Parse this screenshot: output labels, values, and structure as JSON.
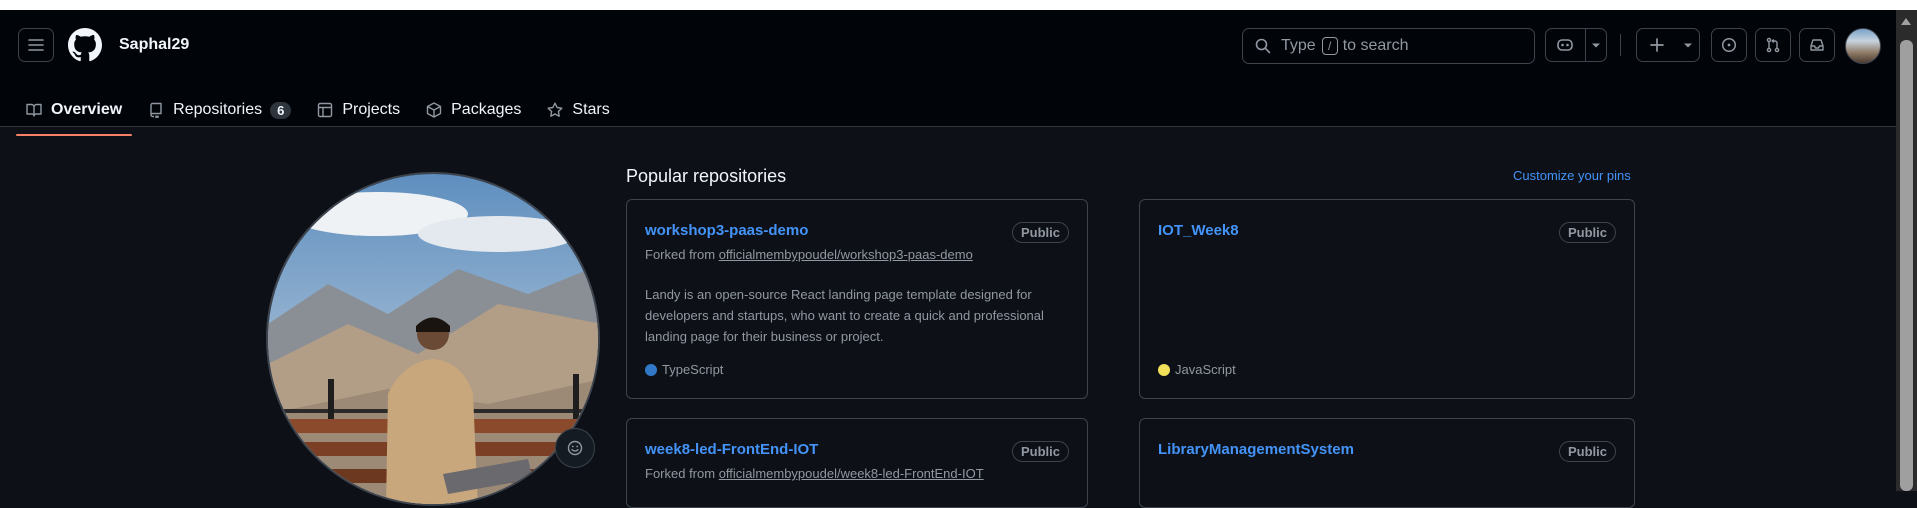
{
  "header": {
    "username": "Saphal29",
    "search_prefix": "Type",
    "search_slash": "/",
    "search_suffix": "to search"
  },
  "nav": {
    "tabs": [
      {
        "label": "Overview",
        "icon": "book-icon",
        "active": true
      },
      {
        "label": "Repositories",
        "icon": "repo-icon",
        "count": "6"
      },
      {
        "label": "Projects",
        "icon": "table-icon"
      },
      {
        "label": "Packages",
        "icon": "package-icon"
      },
      {
        "label": "Stars",
        "icon": "star-icon"
      }
    ]
  },
  "main": {
    "section_title": "Popular repositories",
    "customize_label": "Customize your pins",
    "repos": [
      {
        "name": "workshop3-paas-demo",
        "visibility": "Public",
        "forked_prefix": "Forked from",
        "forked_from": "officialmembypoudel/workshop3-paas-demo",
        "description": "Landy is an open-source React landing page template designed for developers and startups, who want to create a quick and professional landing page for their business or project.",
        "language": "TypeScript",
        "language_color": "#3178c6"
      },
      {
        "name": "IOT_Week8",
        "visibility": "Public",
        "language": "JavaScript",
        "language_color": "#f1e05a"
      },
      {
        "name": "week8-led-FrontEnd-IOT",
        "visibility": "Public",
        "forked_prefix": "Forked from",
        "forked_from": "officialmembypoudel/week8-led-FrontEnd-IOT"
      },
      {
        "name": "LibraryManagementSystem",
        "visibility": "Public"
      }
    ]
  },
  "colors": {
    "background": "#0d1117",
    "header_background": "#010409",
    "link": "#4493f8",
    "active_tab_underline": "#f78166"
  }
}
